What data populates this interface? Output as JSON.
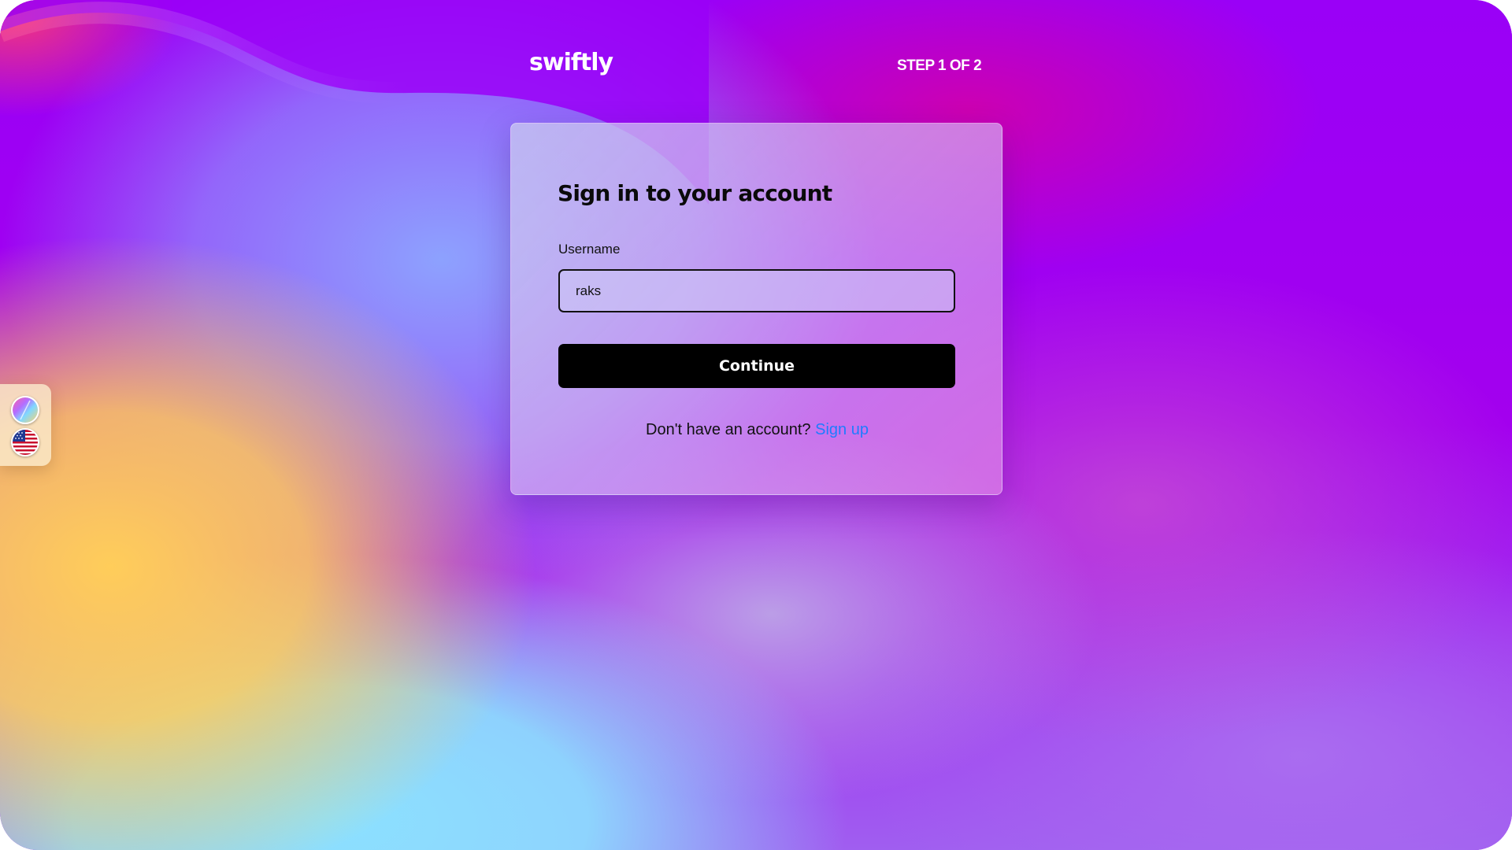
{
  "header": {
    "logo_text": "swiftly",
    "step_text": "STEP 1 OF 2"
  },
  "signin": {
    "title": "Sign in to your account",
    "username_label": "Username",
    "username_value": "raks",
    "continue_label": "Continue",
    "no_account_text": "Don't have an account?",
    "signup_link": "Sign up"
  },
  "side_panel": {
    "icons": [
      "theme-palette-icon",
      "us-flag-icon"
    ]
  },
  "colors": {
    "accent_link": "#1f7cff",
    "button_bg": "#000000",
    "background_primary": "#9a06f5"
  }
}
